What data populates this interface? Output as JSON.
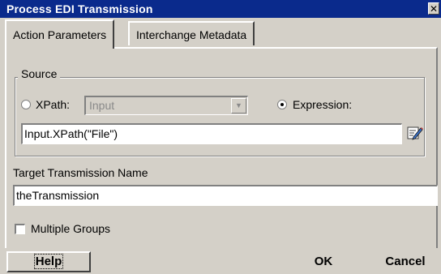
{
  "window": {
    "title": "Process EDI Transmission",
    "close_label": "✕"
  },
  "tabs": [
    {
      "label": "Action Parameters",
      "active": true
    },
    {
      "label": "Interchange Metadata",
      "active": false
    }
  ],
  "source": {
    "legend": "Source",
    "xpath_radio_label": "XPath:",
    "xpath_selected": false,
    "xpath_select_value": "Input",
    "expression_radio_label": "Expression:",
    "expression_selected": true,
    "expression_value": "Input.XPath(\"File\")",
    "editor_icon": "edit-expression-icon"
  },
  "target": {
    "label": "Target Transmission Name",
    "value": "theTransmission"
  },
  "multiple_groups": {
    "label": "Multiple Groups",
    "checked": false
  },
  "buttons": {
    "help": "Help",
    "ok": "OK",
    "cancel": "Cancel"
  },
  "colors": {
    "titlebar": "#0a2a8c",
    "face": "#d4d0c8"
  }
}
